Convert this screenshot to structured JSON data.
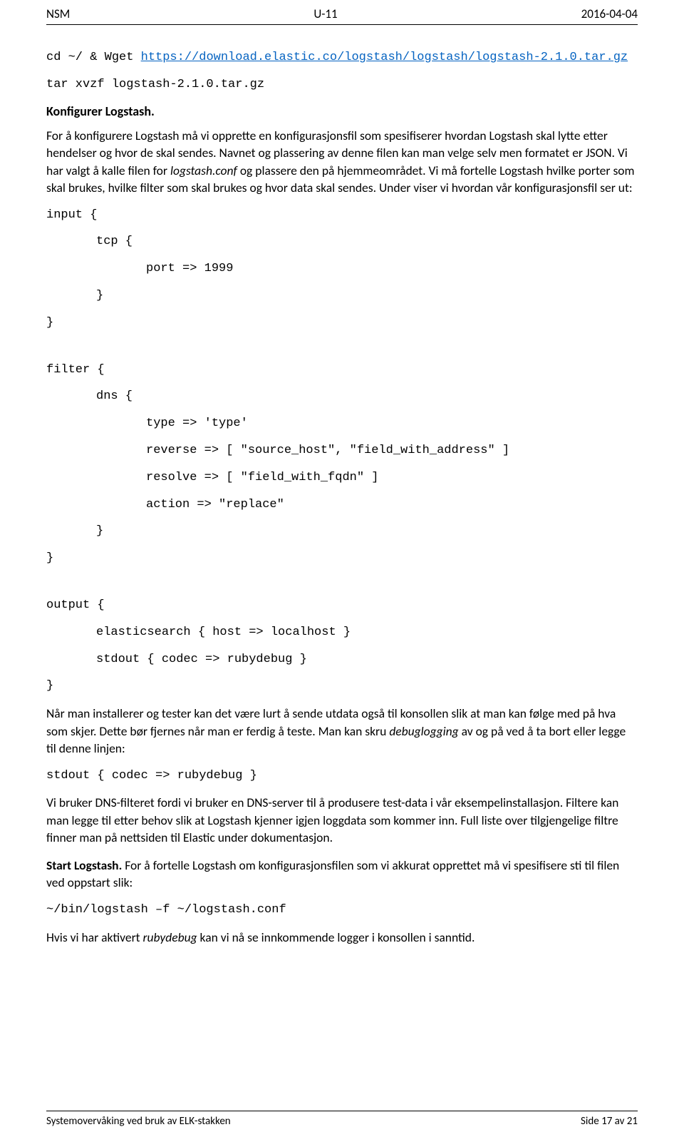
{
  "header": {
    "left": "NSM",
    "center": "U-11",
    "right": "2016-04-04"
  },
  "footer": {
    "left": "Systemovervåking ved bruk av ELK-stakken",
    "right": "Side 17 av 21"
  },
  "cmd1": {
    "prefix": "cd ~/ & Wget ",
    "link": "https://download.elastic.co/logstash/logstash/logstash-2.1.0.tar.gz"
  },
  "cmd2": "tar xvzf logstash-2.1.0.tar.gz",
  "konfigTitle": "Konfigurer Logstash.",
  "para1_pre": "For å konfigurere Logstash må vi opprette en konfigurasjonsfil som spesifiserer hvordan Logstash skal lytte etter hendelser og hvor de skal sendes. Navnet og plassering av denne filen kan man velge selv men formatet er JSON. Vi har valgt å kalle filen for ",
  "para1_it": "logstash.conf ",
  "para1_post": "og plassere den på hjemmeområdet. Vi må fortelle Logstash hvilke porter som skal brukes, hvilke filter som skal brukes og hvor data skal sendes. Under viser vi hvordan vår konfigurasjonsfil ser ut:",
  "input_open": "input {",
  "tcp_open": "tcp {",
  "port_line": "port => 1999",
  "brace_close": "}",
  "filter_open": "filter {",
  "dns_open": "dns {",
  "dns_l1": "type => 'type'",
  "dns_l2": "reverse => [ \"source_host\", \"field_with_address\" ]",
  "dns_l3": "resolve => [ \"field_with_fqdn\" ]",
  "dns_l4": "action => \"replace\"",
  "output_open": "output {",
  "out_l1": "elasticsearch { host => localhost }",
  "out_l2": "stdout { codec => rubydebug }",
  "para2_pre": "Når man installerer og tester kan det være lurt å sende utdata også til konsollen slik at man kan følge med på hva som skjer. Dette bør fjernes når man er ferdig å teste. Man kan skru ",
  "para2_it": "debuglogging",
  "para2_post": " av og på ved å ta bort eller legge til denne linjen:",
  "stdout_line": "stdout { codec => rubydebug }",
  "para3": "Vi bruker DNS-filteret fordi vi bruker en DNS-server til å produsere test-data i vår eksempelinstallasjon. Filtere kan man legge til etter behov slik at Logstash kjenner igjen loggdata som kommer inn. Full liste over tilgjengelige filtre finner man på nettsiden til Elastic under dokumentasjon.",
  "startTitle": "Start Logstash. ",
  "para4": "For å fortelle Logstash om konfigurasjonsfilen som vi akkurat opprettet må vi spesifisere sti til filen ved oppstart slik:",
  "start_cmd": "~/bin/logstash –f ~/logstash.conf",
  "para5_pre": "Hvis vi har aktivert ",
  "para5_it": "rubydebug",
  "para5_post": " kan vi nå se innkommende logger i konsollen i sanntid."
}
